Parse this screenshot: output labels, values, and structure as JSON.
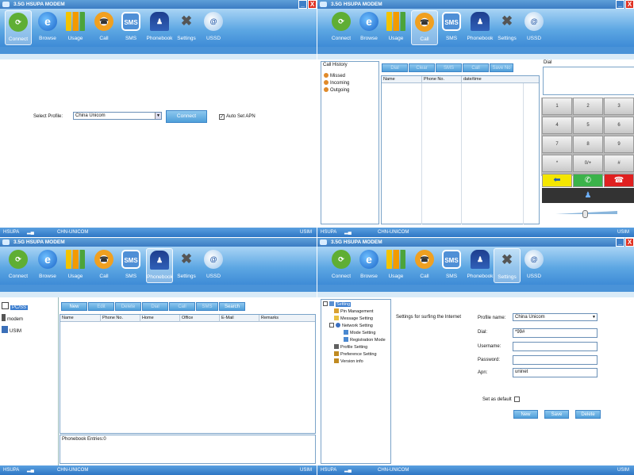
{
  "window_title": "3.5G HSUPA MODEM",
  "window_buttons": {
    "minimize": "_",
    "close": "X"
  },
  "toolbar": [
    "Connect",
    "Browse",
    "Usage",
    "Call",
    "SMS",
    "Phonebook",
    "Settings",
    "USSD"
  ],
  "toolbar_icons": [
    "connect-icon",
    "browse-icon",
    "usage-icon",
    "call-icon",
    "sms-icon",
    "phonebook-icon",
    "settings-icon",
    "ussd-icon"
  ],
  "icon_glyphs": {
    "browse": "e",
    "sms": "SMS",
    "ussd": "@"
  },
  "status": {
    "network": "HSUPA",
    "operator": "CHN-UNICOM",
    "sim": "USIM"
  },
  "connect_screen": {
    "profile_label": "Select Profile:",
    "profile_value": "China Unicom",
    "connect_button": "Connect",
    "auto_apn_label": "Auto Set APN",
    "auto_apn_checked": true
  },
  "call_screen": {
    "history_title": "Call History",
    "history_items": [
      "Missed",
      "Incoming",
      "Outgoing"
    ],
    "buttons": [
      "Dial",
      "Clear",
      "SMS",
      "Call",
      "Save No"
    ],
    "columns": [
      "Name",
      "Phone No.",
      "date/time"
    ],
    "dial_title": "Dial",
    "keypad": [
      "1",
      "2",
      "3",
      "4",
      "5",
      "6",
      "7",
      "8",
      "9",
      "*",
      "0/+",
      "#"
    ]
  },
  "phonebook_screen": {
    "storage": [
      "PC/SS",
      "modem",
      "USIM"
    ],
    "buttons": [
      "New",
      "Edit",
      "Delete",
      "Dial",
      "Call",
      "SMS",
      "Search"
    ],
    "columns": [
      "Name",
      "Phone No.",
      "Home",
      "Office",
      "E-Mail",
      "Remarks"
    ],
    "entries_text": "Phonebook Entries:0"
  },
  "settings_screen": {
    "tree": [
      "Setting",
      "Pin Management",
      "Message Setting",
      "Network Setting",
      "Mode Setting",
      "Registration Mode",
      "Profile Setting",
      "Preference Setting",
      "Version info"
    ],
    "heading": "Settings for surfing the Internet",
    "fields": {
      "profile_name_label": "Profile name:",
      "profile_name": "China Unicom",
      "dial_label": "Dial:",
      "dial": "*99#",
      "username_label": "Username:",
      "username": "",
      "password_label": "Password:",
      "password": "",
      "apn_label": "Apn:",
      "apn": "uninet"
    },
    "default_label": "Set as default",
    "buttons": [
      "New",
      "Save",
      "Delete"
    ]
  },
  "colors": {
    "accent": "#3e8bd6",
    "green_call": "#3bb34a",
    "red_hangup": "#e02020",
    "yellow_back": "#f4e600"
  }
}
